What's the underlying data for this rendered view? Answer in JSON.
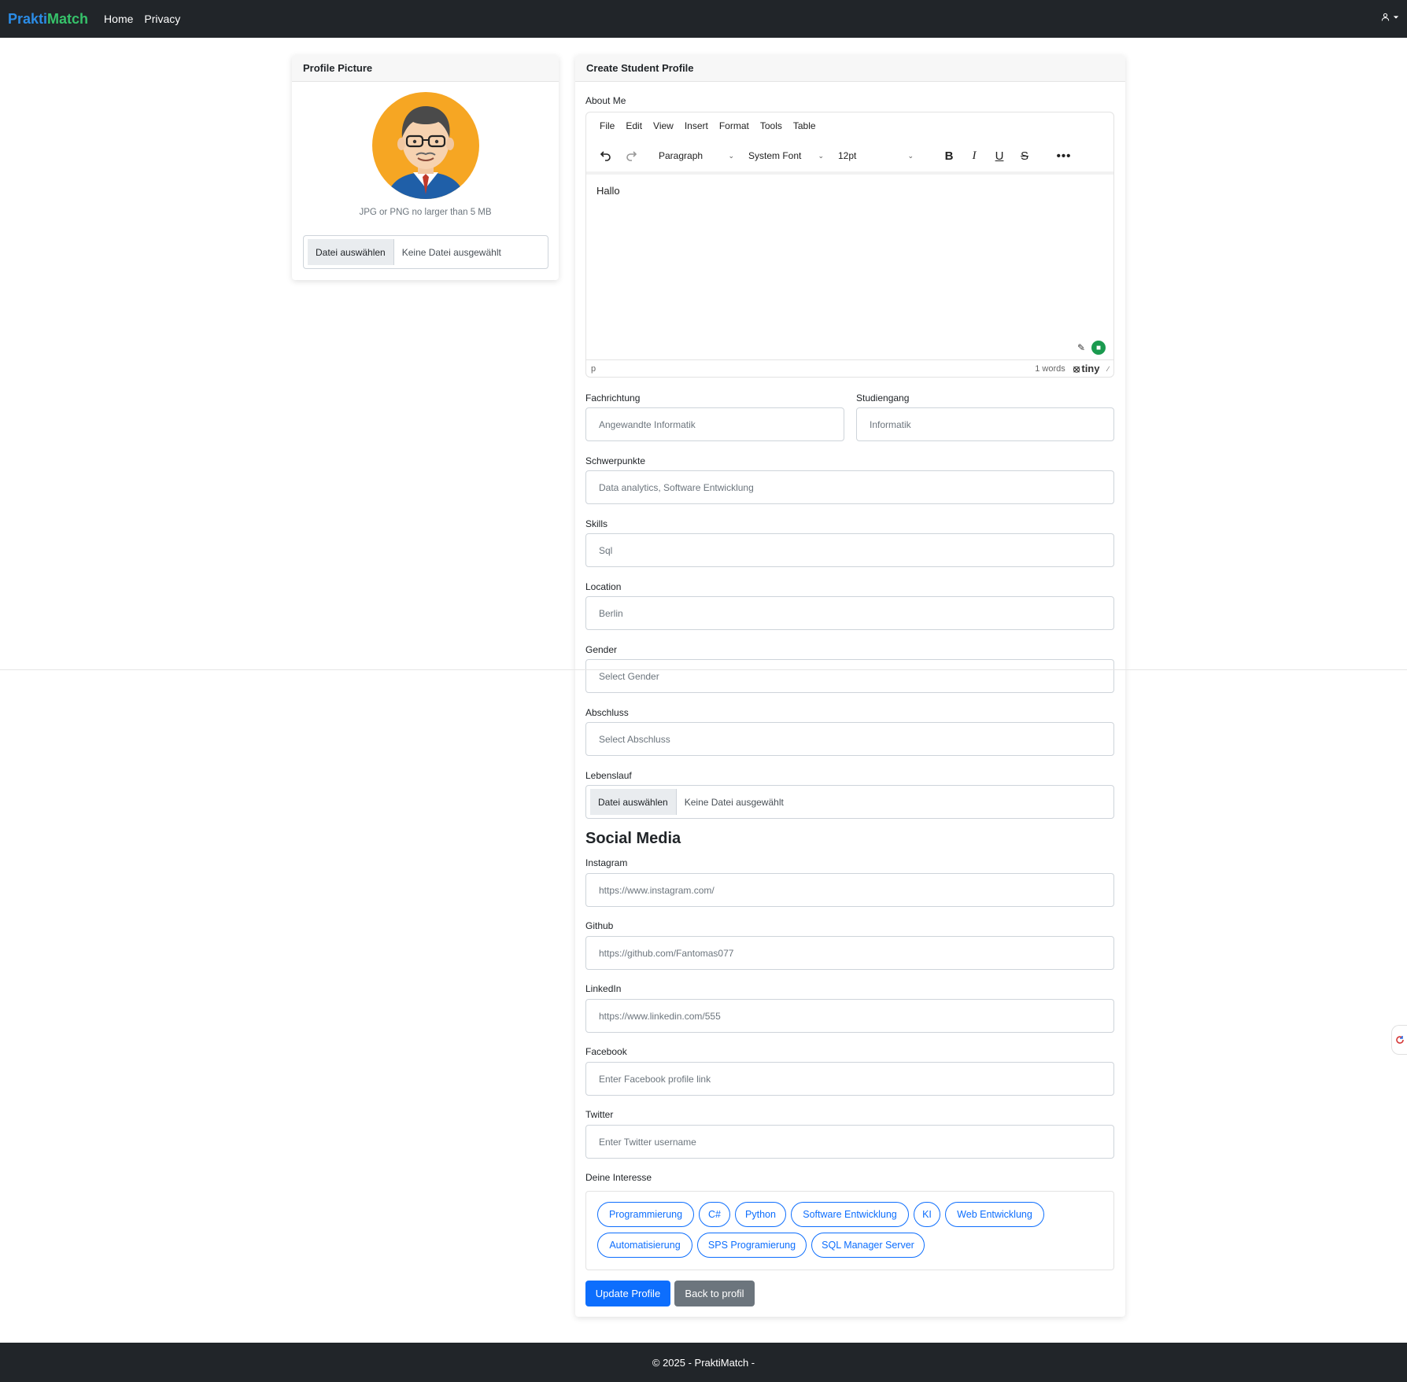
{
  "nav": {
    "brand_part1": "Prakti",
    "brand_part2": "Match",
    "links": [
      "Home",
      "Privacy"
    ],
    "user_icon": "user-icon"
  },
  "profile_picture": {
    "title": "Profile Picture",
    "hint": "JPG or PNG no larger than 5 MB",
    "file_button": "Datei auswählen",
    "file_status": "Keine Datei ausgewählt"
  },
  "profile_form": {
    "title": "Create Student Profile",
    "about_label": "About Me",
    "editor": {
      "menu": [
        "File",
        "Edit",
        "View",
        "Insert",
        "Format",
        "Tools",
        "Table"
      ],
      "block_format": "Paragraph",
      "font_family": "System Font",
      "font_size": "12pt",
      "content": "Hallo",
      "path": "p",
      "word_count": "1 words",
      "brand": "tiny"
    },
    "fachrichtung": {
      "label": "Fachrichtung",
      "value": "Angewandte Informatik"
    },
    "studiengang": {
      "label": "Studiengang",
      "value": "Informatik"
    },
    "schwerpunkte": {
      "label": "Schwerpunkte",
      "value": "Data analytics, Software Entwicklung"
    },
    "skills": {
      "label": "Skills",
      "value": "Sql"
    },
    "location": {
      "label": "Location",
      "value": "Berlin"
    },
    "gender": {
      "label": "Gender",
      "value": "Select Gender"
    },
    "abschluss": {
      "label": "Abschluss",
      "value": "Select Abschluss"
    },
    "lebenslauf": {
      "label": "Lebenslauf",
      "file_button": "Datei auswählen",
      "file_status": "Keine Datei ausgewählt"
    },
    "social_title": "Social Media",
    "instagram": {
      "label": "Instagram",
      "value": "https://www.instagram.com/"
    },
    "github": {
      "label": "Github",
      "value": "https://github.com/Fantomas077"
    },
    "linkedin": {
      "label": "LinkedIn",
      "value": "https://www.linkedin.com/555"
    },
    "facebook": {
      "label": "Facebook",
      "placeholder": "Enter Facebook profile link"
    },
    "twitter": {
      "label": "Twitter",
      "placeholder": "Enter Twitter username"
    },
    "interests_label": "Deine Interesse",
    "interests": [
      "Programmierung",
      "C#",
      "Python",
      "Software Entwicklung",
      "KI",
      "Web Entwicklung",
      "Automatisierung",
      "SPS Programierung",
      "SQL Manager Server"
    ],
    "update_button": "Update Profile",
    "back_button": "Back to profil"
  },
  "footer": {
    "text": "© 2025 - PraktiMatch -"
  },
  "colors": {
    "navbar": "#212529",
    "brand_blue": "#2b8ce6",
    "brand_green": "#36c26a",
    "primary": "#0d6efd",
    "secondary": "#6c757d"
  }
}
